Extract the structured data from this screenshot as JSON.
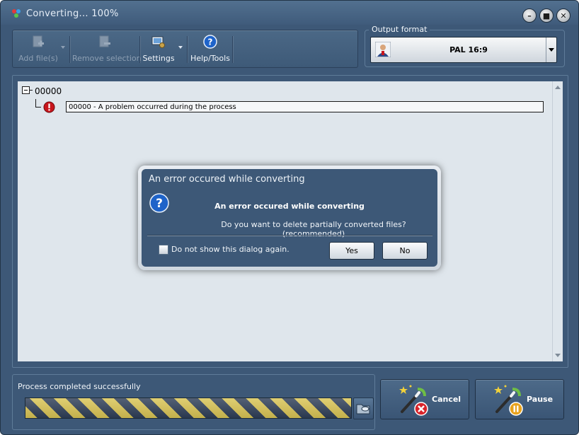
{
  "window": {
    "title": "Converting... 100%",
    "controls": [
      "minimize",
      "maximize",
      "close"
    ]
  },
  "toolbar": {
    "add_files": "Add file(s)",
    "remove_selection": "Remove selection",
    "settings": "Settings",
    "help_tools": "Help/Tools"
  },
  "output": {
    "group_label": "Output format",
    "selected": "PAL 16:9"
  },
  "file_list": {
    "root": "00000",
    "child": "00000 - A problem occurred during the process"
  },
  "dialog": {
    "title": "An error occured while converting",
    "heading": "An error occured while converting",
    "message": "Do you want to delete partially converted files? (recommended)",
    "checkbox_label": "Do not show this dialog again.",
    "checkbox_checked": false,
    "yes": "Yes",
    "no": "No"
  },
  "status": {
    "text": "Process completed successfully",
    "progress_percent": 100
  },
  "actions": {
    "cancel": "Cancel",
    "pause": "Pause"
  },
  "colors": {
    "window_bg": "#3d5877",
    "list_bg": "#dfe6ec",
    "progress_stripe_a": "#d9c454",
    "progress_stripe_b": "#2e3e57",
    "error_red": "#c8161d",
    "help_blue": "#1e63c9"
  },
  "icons": {
    "app": "app-logo-icon",
    "add": "add-file-icon",
    "remove": "remove-file-icon",
    "settings": "settings-icon",
    "help": "help-question-icon",
    "output": "person-format-icon",
    "error": "error-exclamation-icon",
    "dialog": "question-icon",
    "folder": "folder-open-icon",
    "cancel": "wand-cancel-icon",
    "pause": "wand-pause-icon"
  }
}
